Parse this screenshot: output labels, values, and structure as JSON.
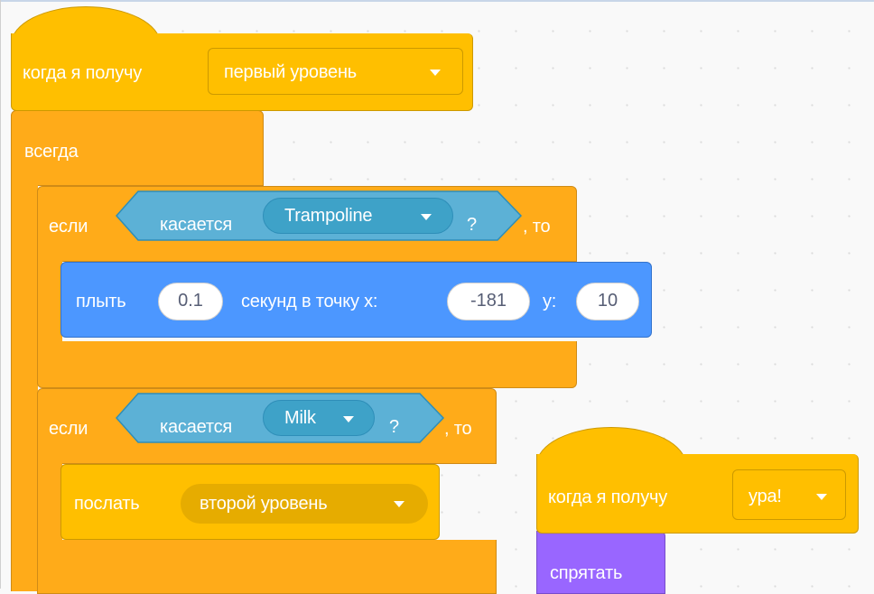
{
  "script1": {
    "hat_label": "когда я получу",
    "hat_message": "первый уровень",
    "forever_label": "всегда",
    "if1": {
      "if_label": "если",
      "sensing_label": "касается",
      "sensing_target": "Trampoline",
      "question_mark": "?",
      "then_label": ", то",
      "glide": {
        "label": "плыть",
        "seconds": "0.1",
        "mid_label": "секунд в точку x:",
        "x_value": "-181",
        "y_label": "y:",
        "y_value": "10"
      }
    },
    "if2": {
      "if_label": "если",
      "sensing_label": "касается",
      "sensing_target": "Milk",
      "question_mark": "?",
      "then_label": ", то",
      "broadcast": {
        "label": "послать",
        "message": "второй уровень"
      }
    }
  },
  "script2": {
    "hat_label": "когда я получу",
    "hat_message": "ура!",
    "hide_label": "спрятать"
  },
  "colors": {
    "events": "#ffbf00",
    "control": "#ffab19",
    "sensing": "#5cb1d6",
    "motion": "#4c97ff",
    "looks": "#9966ff"
  }
}
